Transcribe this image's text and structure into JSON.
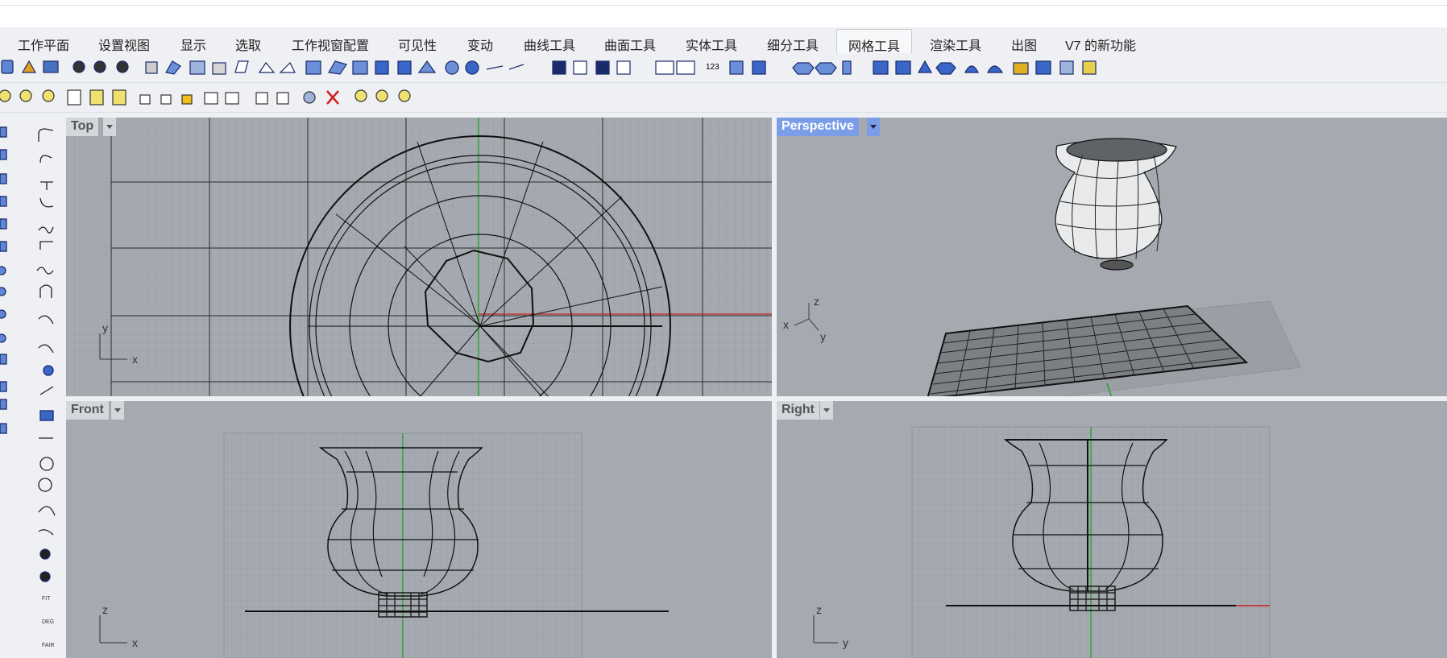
{
  "tabs": [
    {
      "label": "工作平面"
    },
    {
      "label": "设置视图"
    },
    {
      "label": "显示"
    },
    {
      "label": "选取"
    },
    {
      "label": "工作视窗配置"
    },
    {
      "label": "可见性"
    },
    {
      "label": "变动"
    },
    {
      "label": "曲线工具"
    },
    {
      "label": "曲面工具"
    },
    {
      "label": "实体工具"
    },
    {
      "label": "细分工具"
    },
    {
      "label": "网格工具"
    },
    {
      "label": "渲染工具"
    },
    {
      "label": "出图"
    },
    {
      "label": "V7 的新功能"
    }
  ],
  "active_tab": "网格工具",
  "viewports": {
    "top": {
      "label": "Top",
      "axis_a": "x",
      "axis_b": "y"
    },
    "perspective": {
      "label": "Perspective",
      "axis_a": "x",
      "axis_b": "y",
      "axis_c": "z"
    },
    "front": {
      "label": "Front",
      "axis_a": "x",
      "axis_b": "z"
    },
    "right": {
      "label": "Right",
      "axis_a": "y",
      "axis_b": "z"
    }
  },
  "left_toolbar": {
    "fit_label": "FIT",
    "deg_label": "DEG",
    "fair_label": "FAIR"
  },
  "colors": {
    "viewport_bg": "#a5aab1",
    "active_label": "#7b9de8",
    "x_axis": "#c81e1e",
    "y_axis": "#1ea01e"
  }
}
